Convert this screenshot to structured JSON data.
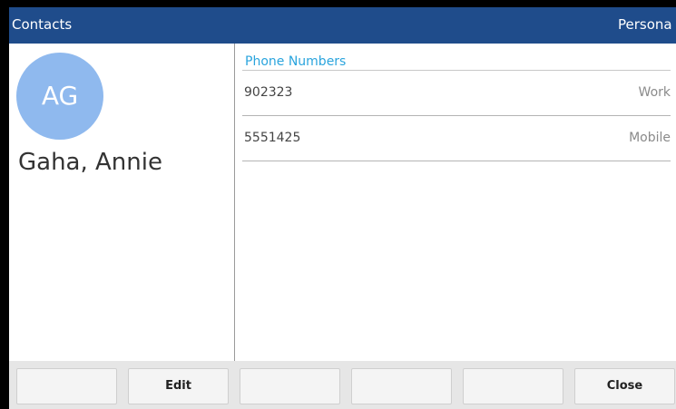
{
  "header": {
    "title": "Contacts",
    "tab_label": "Persona"
  },
  "contact": {
    "initials": "AG",
    "name": "Gaha, Annie",
    "avatar_color": "#8fb9ee"
  },
  "phone_section": {
    "title": "Phone Numbers",
    "entries": [
      {
        "number": "902323",
        "type": "Work"
      },
      {
        "number": "5551425",
        "type": "Mobile"
      }
    ]
  },
  "softkeys": [
    "",
    "Edit",
    "",
    "",
    "",
    "Close"
  ],
  "colors": {
    "header_bg": "#1f4c8b",
    "section_title": "#2aa4dd"
  }
}
